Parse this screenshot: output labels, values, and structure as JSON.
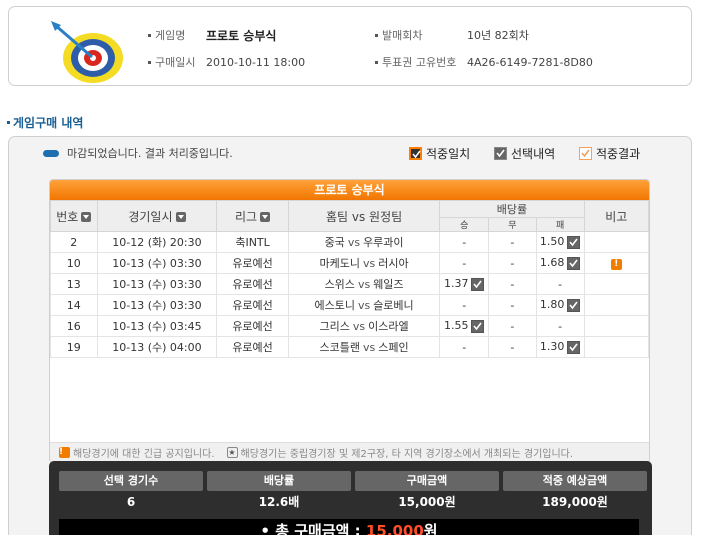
{
  "header": {
    "game_label": "게임명",
    "game_value": "프로토 승부식",
    "round_label": "발매회차",
    "round_value": "10년 82회차",
    "purchase_time_label": "구매일시",
    "purchase_time_value": "2010-10-11 18:00",
    "ticket_id_label": "투표권 고유번호",
    "ticket_id_value": "4A26-6149-7281-8D80",
    "icon": "dartboard-icon"
  },
  "section": {
    "title": "게임구매 내역"
  },
  "status": {
    "message": "마감되었습니다. 결과 처리중입니다."
  },
  "legend": [
    {
      "label": "적중일치",
      "icon": "hit-match-icon"
    },
    {
      "label": "선택내역",
      "icon": "selection-icon"
    },
    {
      "label": "적중결과",
      "icon": "hit-result-icon"
    }
  ],
  "table": {
    "title": "프로토 승부식",
    "columns": {
      "no": "번호",
      "date": "경기일시",
      "league": "리그",
      "teams": "홈팀 vs 원정팀",
      "odds": "배당률",
      "win": "승",
      "draw": "무",
      "lose": "패",
      "note": "비고"
    },
    "vs": "vs",
    "rows": [
      {
        "no": "2",
        "date": "10-12 (화) 20:30",
        "league": "축INTL",
        "home": "중국",
        "away": "우루과이",
        "win": "-",
        "draw": "-",
        "lose": "1.50",
        "note": ""
      },
      {
        "no": "10",
        "date": "10-13 (수) 03:30",
        "league": "유로예선",
        "home": "마케도니",
        "away": "러시아",
        "win": "-",
        "draw": "-",
        "lose": "1.68",
        "note": "!"
      },
      {
        "no": "13",
        "date": "10-13 (수) 03:30",
        "league": "유로예선",
        "home": "스위스",
        "away": "웨일즈",
        "win": "1.37",
        "draw": "-",
        "lose": "-",
        "note": ""
      },
      {
        "no": "14",
        "date": "10-13 (수) 03:30",
        "league": "유로예선",
        "home": "에스토니",
        "away": "슬로베니",
        "win": "-",
        "draw": "-",
        "lose": "1.80",
        "note": ""
      },
      {
        "no": "16",
        "date": "10-13 (수) 03:45",
        "league": "유로예선",
        "home": "그리스",
        "away": "이스라엘",
        "win": "1.55",
        "draw": "-",
        "lose": "-",
        "note": ""
      },
      {
        "no": "19",
        "date": "10-13 (수) 04:00",
        "league": "유로예선",
        "home": "스코틀랜",
        "away": "스페인",
        "win": "-",
        "draw": "-",
        "lose": "1.30",
        "note": ""
      }
    ],
    "footer_notice": "해당경기에 대한 긴급 공지입니다.",
    "footer_notice2": "해당경기는 중립경기장 및 제2구장, 타 지역 경기장소에서 개최되는 경기입니다.",
    "star_glyph": "★"
  },
  "summary": {
    "count_label": "선택 경기수",
    "count_value": "6",
    "odds_label": "배당률",
    "odds_value": "12.6배",
    "amount_label": "구매금액",
    "amount_value": "15,000원",
    "expected_label": "적중 예상금액",
    "expected_value": "189,000원",
    "total_label": "• 총 구매금액 :",
    "total_value": "15,000",
    "total_unit": "원"
  },
  "colors": {
    "accent_orange": "#f17600",
    "title_blue": "#1a5f93",
    "status_blue": "#1e6fb0",
    "total_red": "#ff4e2a"
  }
}
